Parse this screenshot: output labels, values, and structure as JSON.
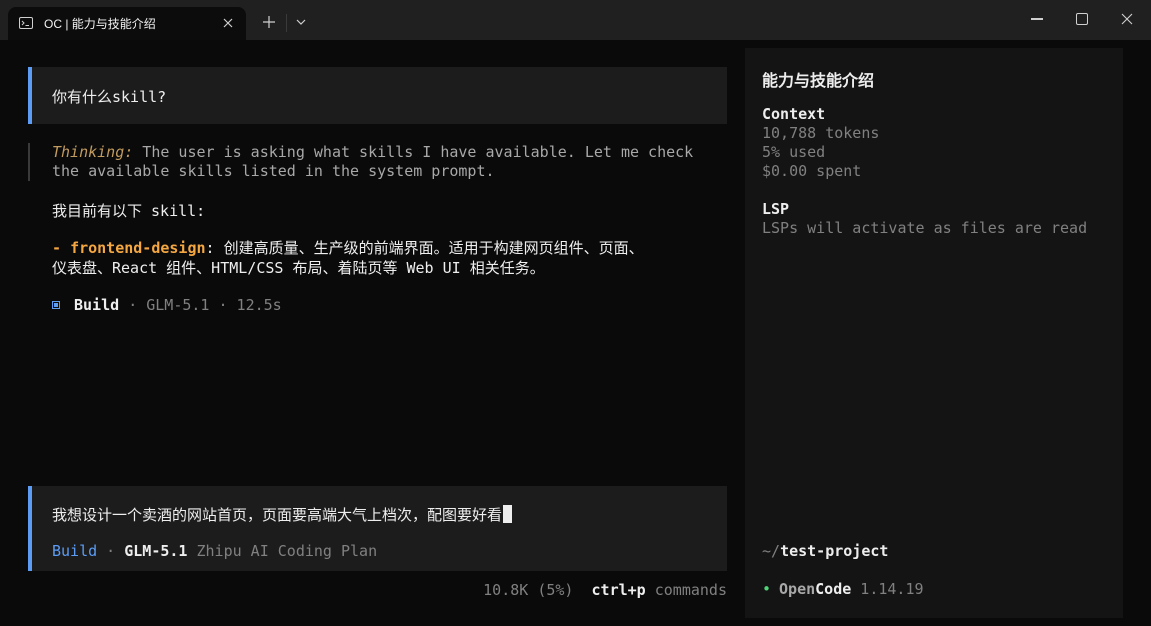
{
  "window": {
    "tab_title": "OC | 能力与技能介绍"
  },
  "conversation": {
    "user_message": "你有什么skill?",
    "thinking_label": "Thinking:",
    "thinking_line1": " The user is asking what skills I have available. Let me check",
    "thinking_line2": "the available skills listed in the system prompt.",
    "answer_intro": "我目前有以下 skill:",
    "skill": {
      "dash": "- ",
      "name": "frontend-design",
      "desc_line1": ": 创建高质量、生产级的前端界面。适用于构建网页组件、页面、",
      "desc_line2": "仪表盘、React 组件、HTML/CSS 布局、着陆页等 Web UI 相关任务。"
    },
    "status": {
      "agent": "Build",
      "model": "· GLM-5.1 · 12.5s"
    }
  },
  "input": {
    "text": "我想设计一个卖酒的网站首页，页面要高端大气上档次，配图要好看",
    "agent": "Build",
    "separator": " · ",
    "model": "GLM-5.1",
    "provider": " Zhipu AI Coding Plan"
  },
  "footer": {
    "tokens": "10.8K (5%)",
    "shortcut_key": "ctrl+p",
    "shortcut_label": " commands"
  },
  "sidebar": {
    "title": "能力与技能介绍",
    "context_title": "Context",
    "tokens": "10,788 tokens",
    "used": "5% used",
    "spent": "$0.00 spent",
    "lsp_title": "LSP",
    "lsp_status": "LSPs will activate as files are read",
    "project_tilde": "~/",
    "project_name": "test-project",
    "bullet": "•",
    "brand_open": "Open",
    "brand_code": "Code",
    "version": " 1.14.19"
  },
  "colors": {
    "accent": "#5c9cf5",
    "skill": "#f5a742",
    "thinking": "#c29b5f",
    "status_dot": "#4fd67a"
  }
}
